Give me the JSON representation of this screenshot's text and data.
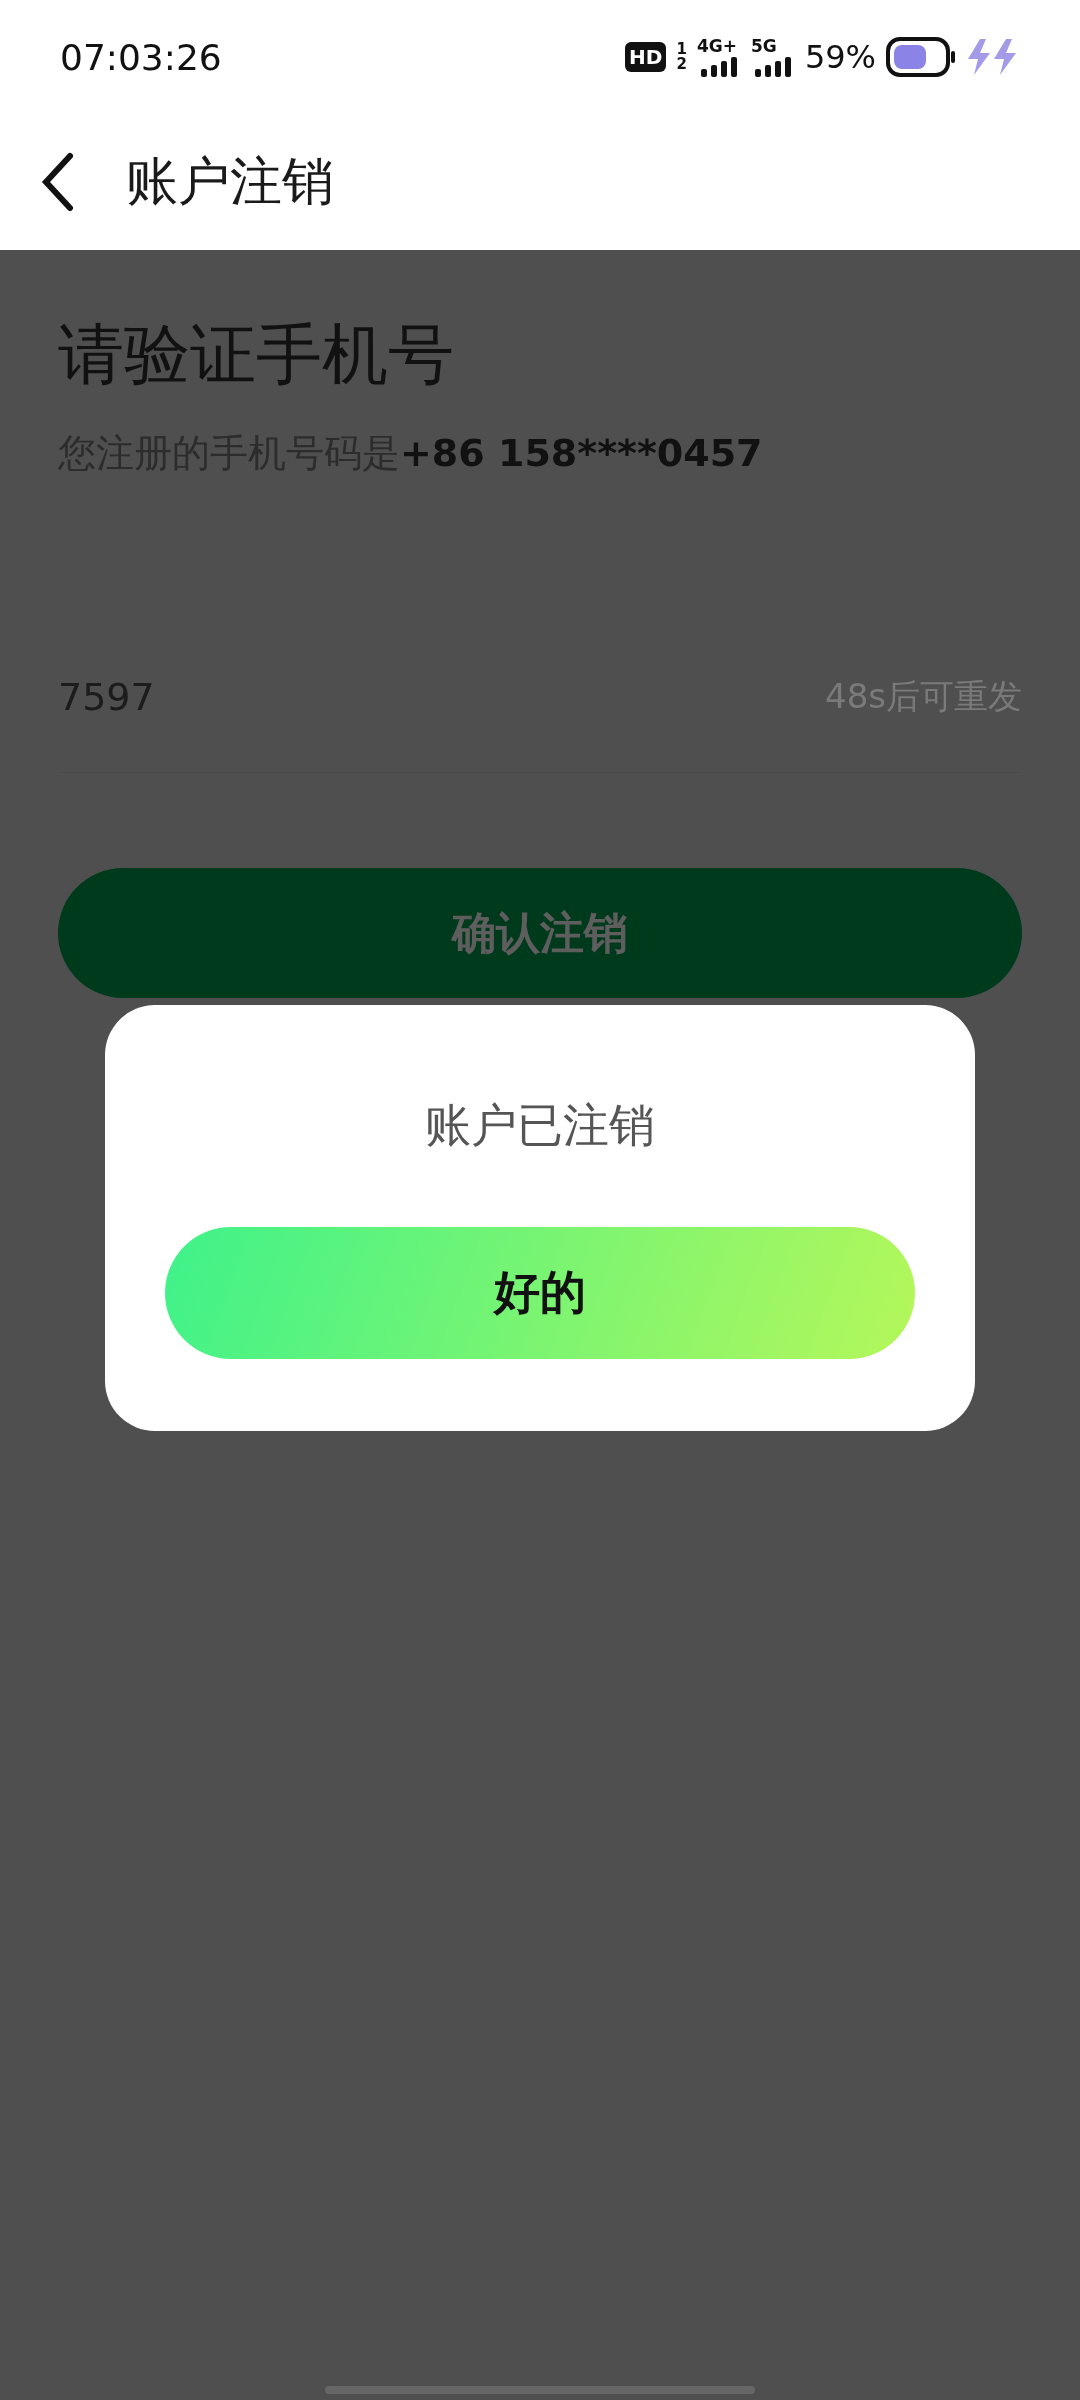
{
  "status_bar": {
    "time": "07:03:26",
    "hd": "HD",
    "sim_numbers": [
      "1",
      "2"
    ],
    "networks": [
      "4G+",
      "5G"
    ],
    "battery": "59%"
  },
  "header": {
    "title": "账户注销"
  },
  "page": {
    "title": "请验证手机号",
    "subtitle": "您注册的手机号码是",
    "phone": "+86 158****0457",
    "code": {
      "value": "7597",
      "resend": "48s后可重发"
    },
    "confirm_button": "确认注销"
  },
  "dialog": {
    "message": "账户已注销",
    "ok_button": "好的"
  }
}
